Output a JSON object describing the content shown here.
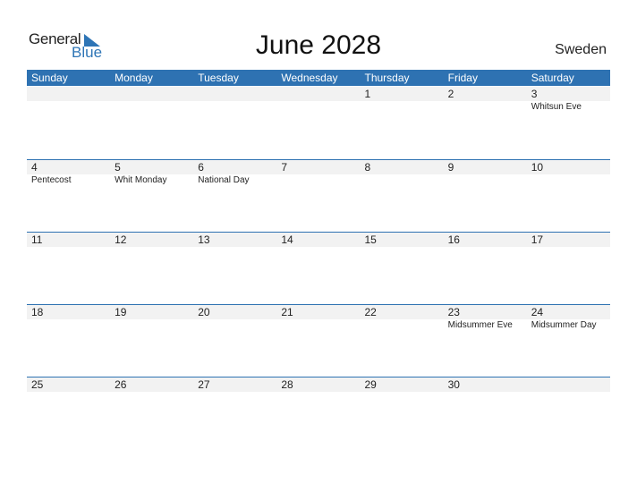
{
  "logo": {
    "general": "General",
    "blue": "Blue"
  },
  "title": "June 2028",
  "country": "Sweden",
  "colors": {
    "accent": "#2e72b2",
    "band": "#f2f2f2"
  },
  "weekdays": [
    "Sunday",
    "Monday",
    "Tuesday",
    "Wednesday",
    "Thursday",
    "Friday",
    "Saturday"
  ],
  "weeks": [
    [
      {
        "day": "",
        "holiday": ""
      },
      {
        "day": "",
        "holiday": ""
      },
      {
        "day": "",
        "holiday": ""
      },
      {
        "day": "",
        "holiday": ""
      },
      {
        "day": "1",
        "holiday": ""
      },
      {
        "day": "2",
        "holiday": ""
      },
      {
        "day": "3",
        "holiday": "Whitsun Eve"
      }
    ],
    [
      {
        "day": "4",
        "holiday": "Pentecost"
      },
      {
        "day": "5",
        "holiday": "Whit Monday"
      },
      {
        "day": "6",
        "holiday": "National Day"
      },
      {
        "day": "7",
        "holiday": ""
      },
      {
        "day": "8",
        "holiday": ""
      },
      {
        "day": "9",
        "holiday": ""
      },
      {
        "day": "10",
        "holiday": ""
      }
    ],
    [
      {
        "day": "11",
        "holiday": ""
      },
      {
        "day": "12",
        "holiday": ""
      },
      {
        "day": "13",
        "holiday": ""
      },
      {
        "day": "14",
        "holiday": ""
      },
      {
        "day": "15",
        "holiday": ""
      },
      {
        "day": "16",
        "holiday": ""
      },
      {
        "day": "17",
        "holiday": ""
      }
    ],
    [
      {
        "day": "18",
        "holiday": ""
      },
      {
        "day": "19",
        "holiday": ""
      },
      {
        "day": "20",
        "holiday": ""
      },
      {
        "day": "21",
        "holiday": ""
      },
      {
        "day": "22",
        "holiday": ""
      },
      {
        "day": "23",
        "holiday": "Midsummer Eve"
      },
      {
        "day": "24",
        "holiday": "Midsummer Day"
      }
    ],
    [
      {
        "day": "25",
        "holiday": ""
      },
      {
        "day": "26",
        "holiday": ""
      },
      {
        "day": "27",
        "holiday": ""
      },
      {
        "day": "28",
        "holiday": ""
      },
      {
        "day": "29",
        "holiday": ""
      },
      {
        "day": "30",
        "holiday": ""
      },
      {
        "day": "",
        "holiday": ""
      }
    ]
  ]
}
